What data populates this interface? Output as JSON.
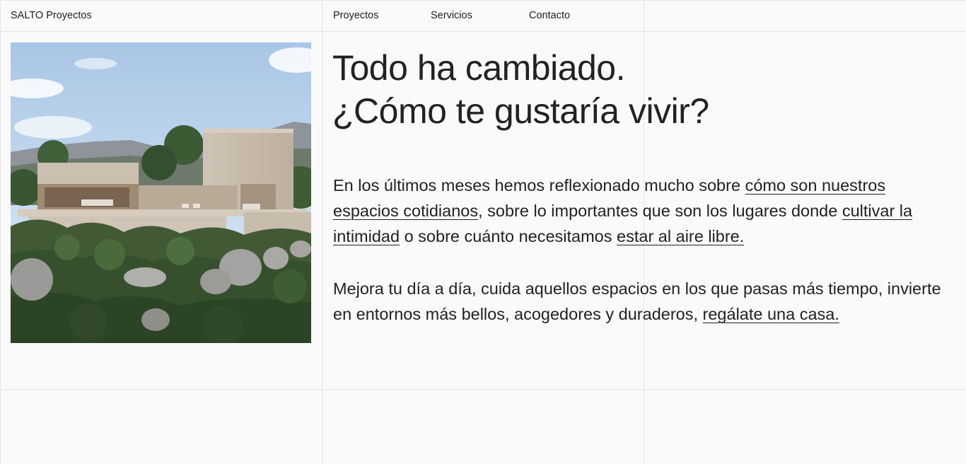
{
  "header": {
    "logo": "SALTO Proyectos",
    "nav": [
      "Proyectos",
      "Servicios",
      "Contacto"
    ]
  },
  "hero": {
    "image_alt": "Casa contemporánea de piedra entre vegetación y rocas",
    "title_line1": "Todo ha cambiado.",
    "title_line2": "¿Cómo te gustaría vivir?"
  },
  "intro": {
    "p1_t1": "En los últimos meses hemos reflexionado mucho sobre ",
    "p1_link1": "cómo son nuestros espacios cotidianos",
    "p1_t2": ", sobre lo importantes que son los lugares donde ",
    "p1_link2": "cultivar la intimidad",
    "p1_t3": " o sobre cuánto necesitamos ",
    "p1_link3": "estar al aire libre.",
    "p2_t1": "Mejora tu día a día, cuida aquellos espacios en los que pasas más tiempo, invierte en entornos más bellos, acogedores y duraderos, ",
    "p2_link1": "regálate una casa."
  }
}
